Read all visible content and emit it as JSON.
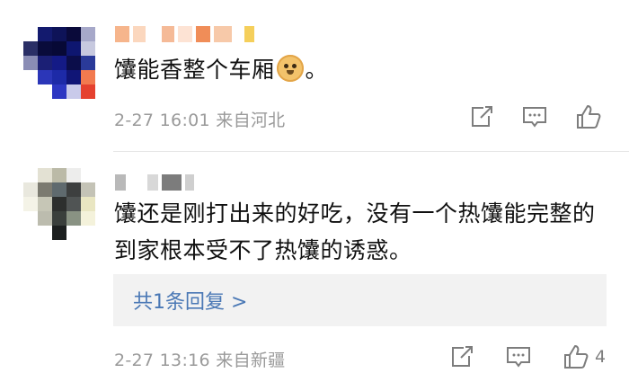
{
  "comments": [
    {
      "text": "馕能香整个车厢",
      "text_suffix": "。",
      "emoji": "doge-emoji",
      "date": "2-27",
      "time": "16:01",
      "location": "来自河北",
      "like_count": "",
      "icons": [
        "share-icon",
        "comment-icon",
        "thumbs-up-icon"
      ]
    },
    {
      "text": "馕还是刚打出来的好吃，没有一个热馕能完整的到家根本受不了热馕的诱惑。",
      "date": "2-27",
      "time": "13:16",
      "location": "来自新疆",
      "replies_label": "共1条回复 >",
      "like_count": "4",
      "icons": [
        "share-icon",
        "comment-icon",
        "thumbs-up-icon"
      ]
    }
  ],
  "colors": {
    "link_blue": "#4a78b5",
    "meta_gray": "#9a9a9a",
    "reply_bg": "#f2f2f2"
  }
}
